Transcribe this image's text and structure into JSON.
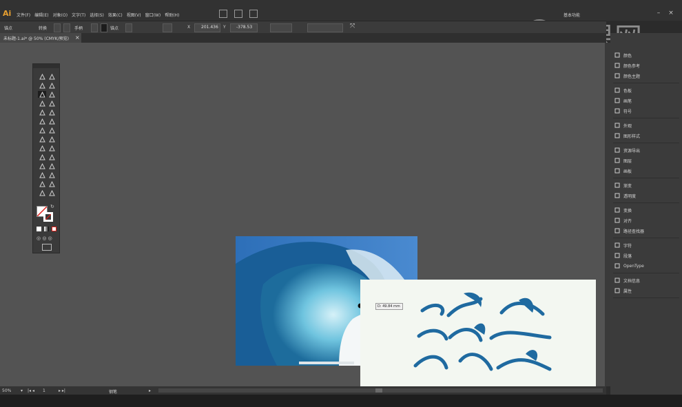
{
  "app": {
    "logo": "Ai"
  },
  "menu": [
    "文件(F)",
    "编辑(E)",
    "对象(O)",
    "文字(T)",
    "选择(S)",
    "效果(C)",
    "视图(V)",
    "窗口(W)",
    "帮助(H)"
  ],
  "workspace": "基本功能",
  "watermark": "虎课网",
  "control_bar": {
    "path_label": "锚点",
    "convert_label": "转换",
    "handle_label": "手柄",
    "anchor_label": "锚点",
    "x_label": "X",
    "x_value": "201.436",
    "y_label": "Y",
    "y_value": "-378.53"
  },
  "document_tab": {
    "title": "未标题-1.ai* @ 50% (CMYK/预览)",
    "close": "×"
  },
  "measure_tooltip": "D: 49.84 mm",
  "panels": [
    {
      "label": "颜色",
      "icon": "color-icon"
    },
    {
      "label": "颜色参考",
      "icon": "color-guide-icon"
    },
    {
      "label": "颜色主题",
      "icon": "color-themes-icon"
    },
    {
      "label": "色板",
      "icon": "swatches-icon"
    },
    {
      "label": "画笔",
      "icon": "brushes-icon"
    },
    {
      "label": "符号",
      "icon": "symbols-icon"
    },
    {
      "label": "外观",
      "icon": "appearance-icon"
    },
    {
      "label": "图形样式",
      "icon": "graphic-styles-icon"
    },
    {
      "label": "资源导出",
      "icon": "asset-export-icon"
    },
    {
      "label": "图层",
      "icon": "layers-icon"
    },
    {
      "label": "画板",
      "icon": "artboards-icon"
    },
    {
      "label": "渐变",
      "icon": "gradient-icon"
    },
    {
      "label": "透明度",
      "icon": "transparency-icon"
    },
    {
      "label": "变换",
      "icon": "transform-icon"
    },
    {
      "label": "对齐",
      "icon": "align-icon"
    },
    {
      "label": "路径查找器",
      "icon": "pathfinder-icon"
    },
    {
      "label": "字符",
      "icon": "character-icon"
    },
    {
      "label": "段落",
      "icon": "paragraph-icon"
    },
    {
      "label": "OpenType",
      "icon": "opentype-icon"
    },
    {
      "label": "文档信息",
      "icon": "document-info-icon"
    },
    {
      "label": "属性",
      "icon": "attributes-icon"
    }
  ],
  "status": {
    "zoom": "50%",
    "page": "1",
    "tool_name": "钢笔"
  },
  "colors": {
    "canvas": "#535353",
    "panel": "#3b3b3b",
    "accent": "#e8a030",
    "wave_blue": "#1f6aa0"
  }
}
